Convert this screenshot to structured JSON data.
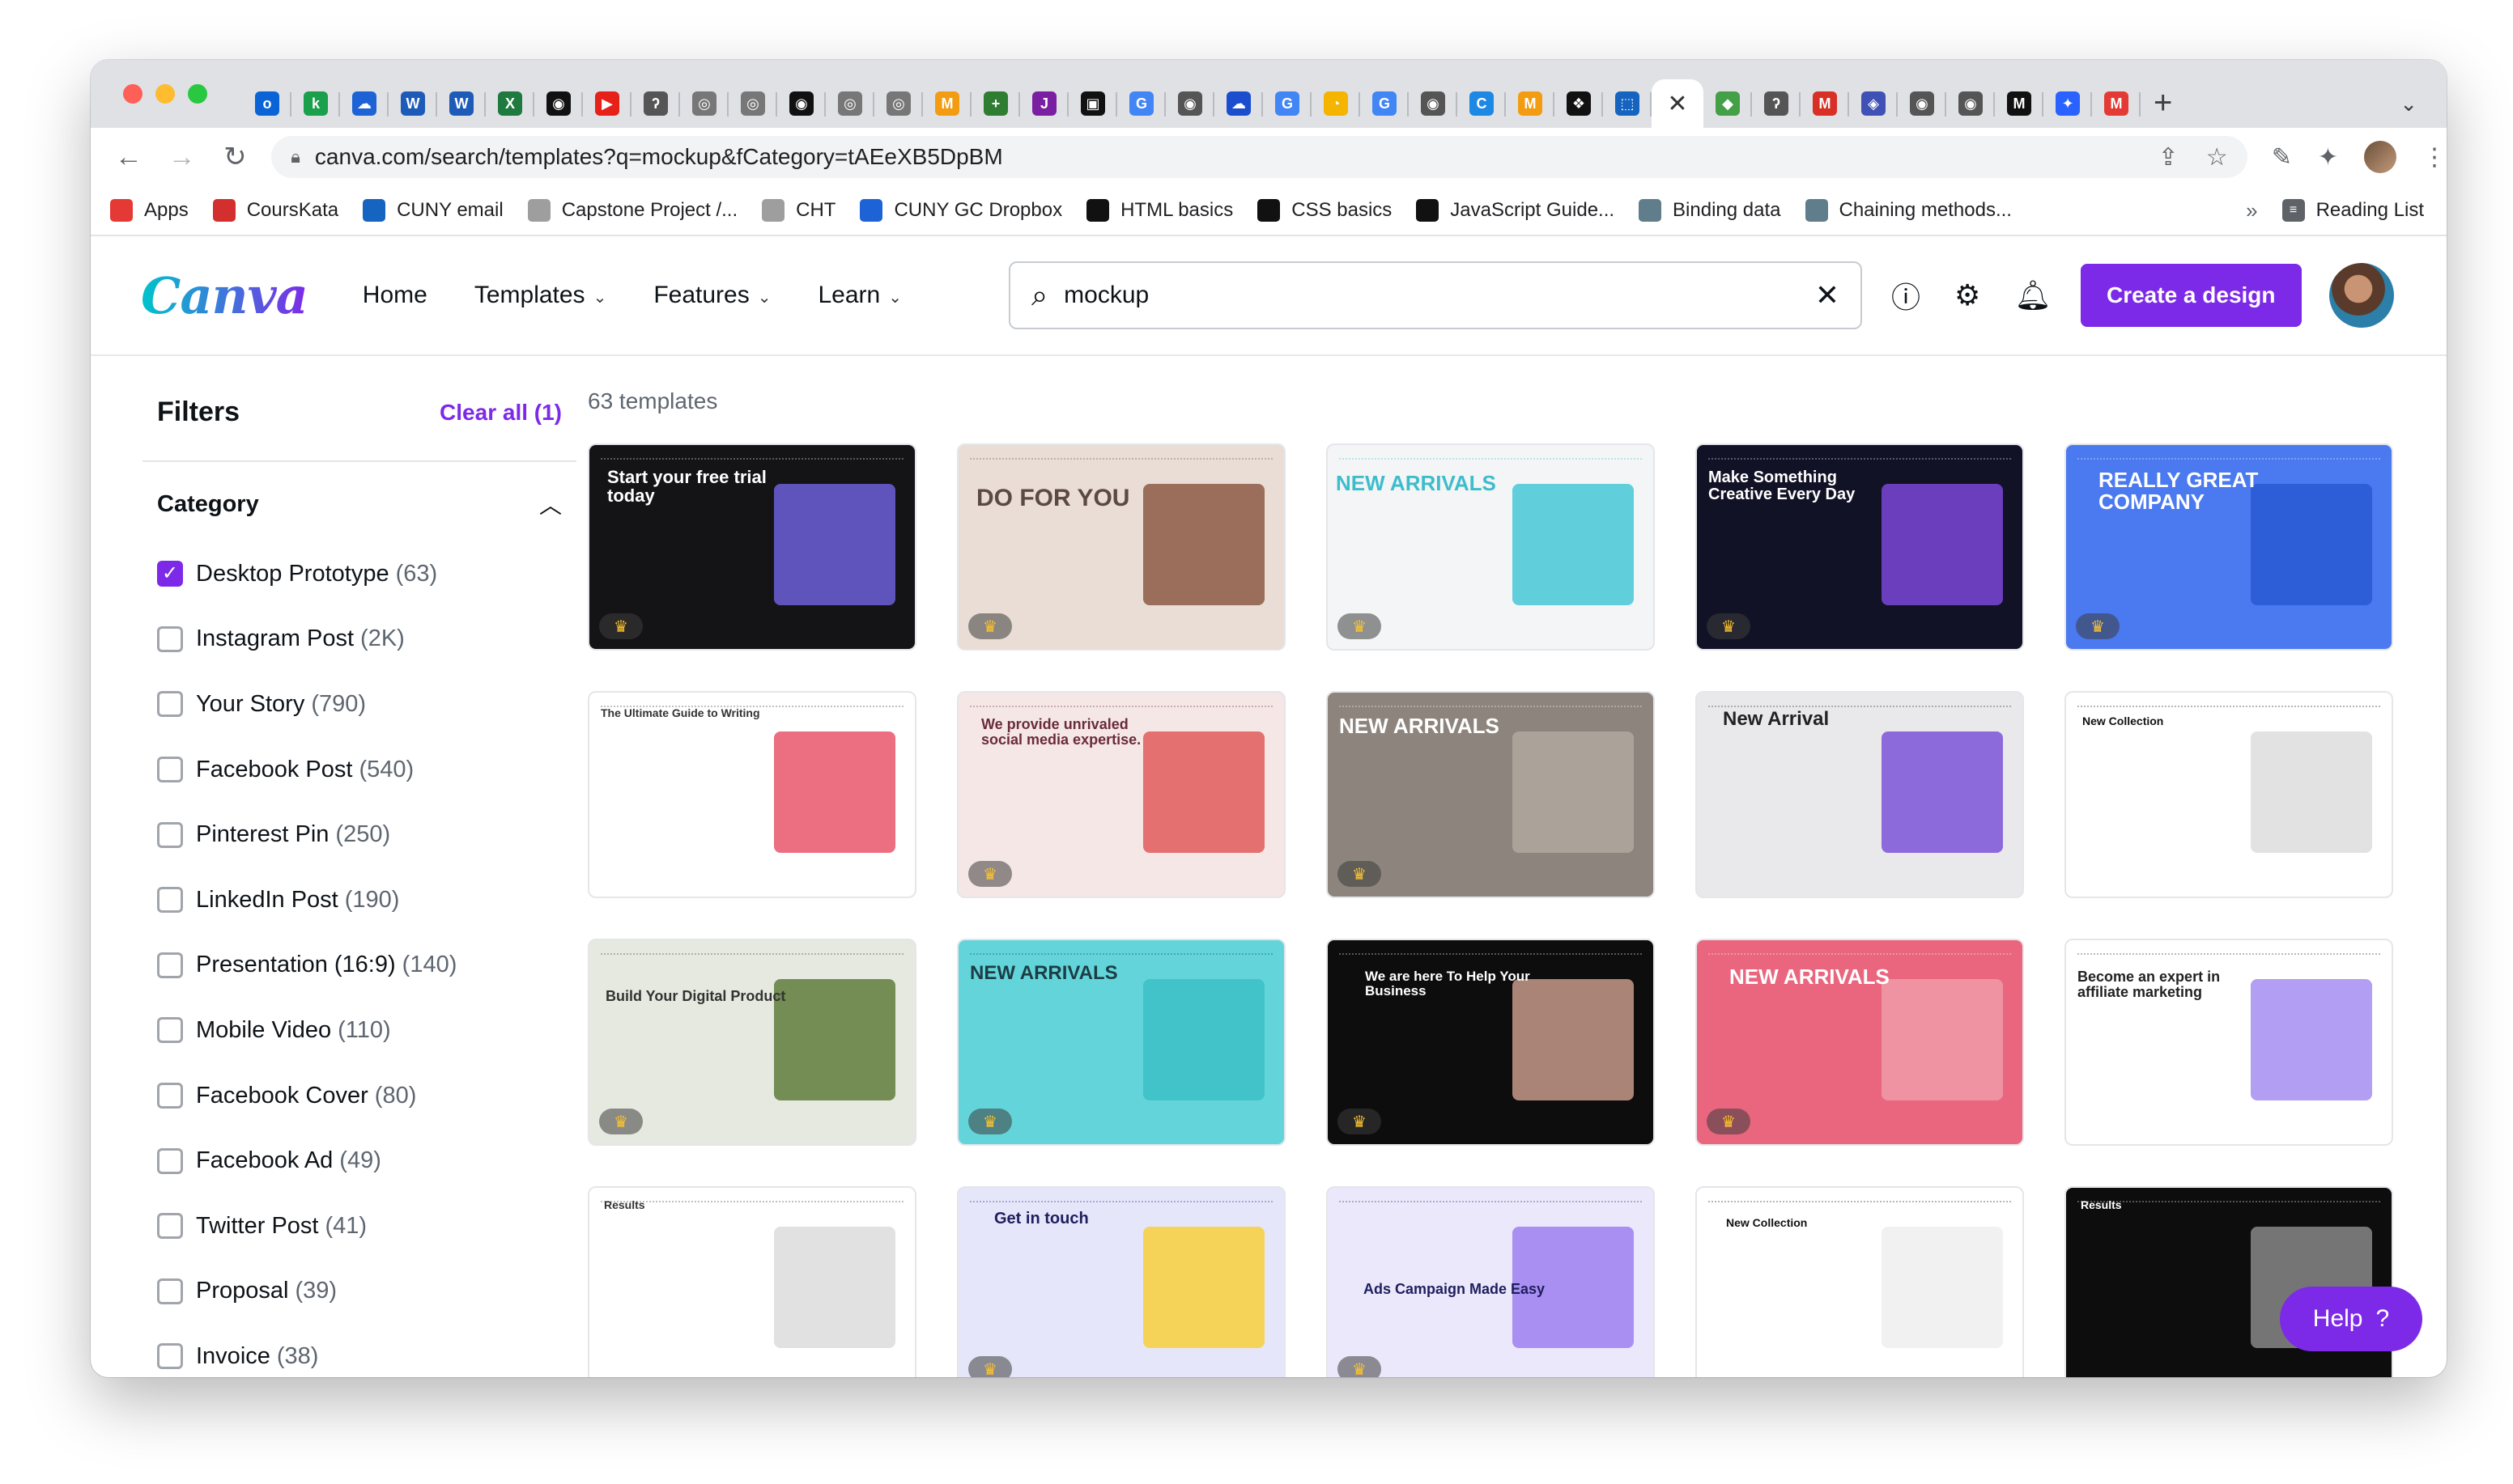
{
  "browser": {
    "active_tab_close": "✕",
    "new_tab": "+",
    "url": "canva.com/search/templates?q=mockup&fCategory=tAEeXB5DpBM",
    "tab_favicons": [
      "o",
      "k",
      "☁",
      "W",
      "W",
      "X",
      "◉",
      "▶",
      "ʔ",
      "◎",
      "◎",
      "◉",
      "◎",
      "◎",
      "M",
      "+",
      "J",
      "▣",
      "G",
      "◉",
      "☁",
      "G",
      "◔",
      "G",
      "◉",
      "C",
      "M",
      "❖",
      "⬚",
      "◆",
      "ʔ",
      "M",
      "◈",
      "◉",
      "◉",
      "M",
      "✦",
      "M"
    ]
  },
  "bookmarks": [
    {
      "label": "Apps",
      "color": "#e53935"
    },
    {
      "label": "CoursKata",
      "color": "#d32f2f"
    },
    {
      "label": "CUNY email",
      "color": "#1565c0"
    },
    {
      "label": "Capstone Project /...",
      "color": "#9e9e9e"
    },
    {
      "label": "CHT",
      "color": "#9e9e9e"
    },
    {
      "label": "CUNY GC Dropbox",
      "color": "#1e63d6"
    },
    {
      "label": "HTML basics",
      "color": "#111111"
    },
    {
      "label": "CSS basics",
      "color": "#111111"
    },
    {
      "label": "JavaScript Guide...",
      "color": "#111111"
    },
    {
      "label": "Binding data",
      "color": "#607d8b"
    },
    {
      "label": "Chaining methods...",
      "color": "#607d8b"
    }
  ],
  "bookmarks_more": "»",
  "reading_list": "Reading List",
  "canva": {
    "logo": "Canva",
    "nav": [
      "Home",
      "Templates",
      "Features",
      "Learn"
    ],
    "search_value": "mockup",
    "create_label": "Create a design",
    "help_label": "Help",
    "brand_color": "#7d2ae8"
  },
  "filters": {
    "title": "Filters",
    "clear_all": "Clear all (1)",
    "category_title": "Category",
    "items": [
      {
        "label": "Desktop Prototype",
        "count": "(63)",
        "checked": true
      },
      {
        "label": "Instagram Post",
        "count": "(2K)",
        "checked": false
      },
      {
        "label": "Your Story",
        "count": "(790)",
        "checked": false
      },
      {
        "label": "Facebook Post",
        "count": "(540)",
        "checked": false
      },
      {
        "label": "Pinterest Pin",
        "count": "(250)",
        "checked": false
      },
      {
        "label": "LinkedIn Post",
        "count": "(190)",
        "checked": false
      },
      {
        "label": "Presentation (16:9)",
        "count": "(140)",
        "checked": false
      },
      {
        "label": "Mobile Video",
        "count": "(110)",
        "checked": false
      },
      {
        "label": "Facebook Cover",
        "count": "(80)",
        "checked": false
      },
      {
        "label": "Facebook Ad",
        "count": "(49)",
        "checked": false
      },
      {
        "label": "Twitter Post",
        "count": "(41)",
        "checked": false
      },
      {
        "label": "Proposal",
        "count": "(39)",
        "checked": false
      },
      {
        "label": "Invoice",
        "count": "(38)",
        "checked": false
      }
    ]
  },
  "results": {
    "count": "63 templates",
    "cards": [
      {
        "title": "Start your free trial today",
        "bg": "#141417",
        "accent": "#6b5fd8",
        "text": "#ffffff",
        "premium": true
      },
      {
        "title": "DO FOR YOU",
        "bg": "#e9ddd5",
        "accent": "#8c5a45",
        "text": "#5b4a42",
        "premium": true
      },
      {
        "title": "NEW ARRIVALS",
        "bg": "#f3f5f6",
        "accent": "#45c8d6",
        "text": "#3dbdcc",
        "premium": true
      },
      {
        "title": "Make Something Creative Every Day",
        "bg": "#121226",
        "accent": "#7b46d8",
        "text": "#ffffff",
        "premium": true
      },
      {
        "title": "REALLY GREAT COMPANY",
        "bg": "#4a79f0",
        "accent": "#2958d4",
        "text": "#ffffff",
        "premium": true
      },
      {
        "title": "The Ultimate Guide to Writing",
        "bg": "#ffffff",
        "accent": "#e8566a",
        "text": "#333333",
        "premium": false
      },
      {
        "title": "We provide unrivaled social media expertise.",
        "bg": "#f5e7e5",
        "accent": "#e05a5a",
        "text": "#6a2b3a",
        "premium": true
      },
      {
        "title": "NEW ARRIVALS",
        "bg": "#8d857d",
        "accent": "#b0a89e",
        "text": "#ffffff",
        "premium": true
      },
      {
        "title": "New Arrival",
        "bg": "#e9e9ec",
        "accent": "#7d54d8",
        "text": "#222222",
        "premium": false
      },
      {
        "title": "New Collection",
        "bg": "#ffffff",
        "accent": "#dddddd",
        "text": "#111111",
        "premium": false
      },
      {
        "title": "Build Your Digital Product",
        "bg": "#e6e9df",
        "accent": "#5e7c3c",
        "text": "#333333",
        "premium": true
      },
      {
        "title": "NEW ARRIVALS",
        "bg": "#63d5da",
        "accent": "#3cc0c6",
        "text": "#1c3d44",
        "premium": true
      },
      {
        "title": "We are here To Help Your Business",
        "bg": "#0d0d0d",
        "accent": "#c79a8a",
        "text": "#ffffff",
        "premium": true
      },
      {
        "title": "NEW ARRIVALS",
        "bg": "#e9667e",
        "accent": "#f09aa8",
        "text": "#ffffff",
        "premium": true
      },
      {
        "title": "Become an expert in affiliate marketing",
        "bg": "#ffffff",
        "accent": "#a58df0",
        "text": "#222222",
        "premium": false
      },
      {
        "title": "Results",
        "bg": "#ffffff",
        "accent": "#dcdcdc",
        "text": "#333333",
        "premium": false
      },
      {
        "title": "Get in touch",
        "bg": "#e6e6fb",
        "accent": "#f7cf3b",
        "text": "#1e1e5e",
        "premium": true
      },
      {
        "title": "Ads Campaign Made Easy",
        "bg": "#ebe8fb",
        "accent": "#9e7ff0",
        "text": "#1e1e5e",
        "premium": true
      },
      {
        "title": "New Collection",
        "bg": "#ffffff",
        "accent": "#eeeeee",
        "text": "#111111",
        "premium": false
      },
      {
        "title": "Results",
        "bg": "#0d0d0d",
        "accent": "#888888",
        "text": "#ffffff",
        "premium": false
      }
    ]
  }
}
